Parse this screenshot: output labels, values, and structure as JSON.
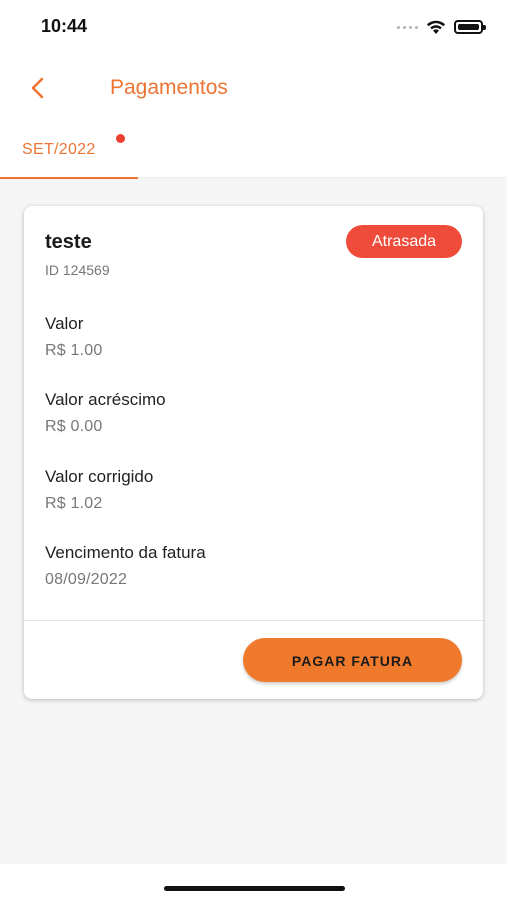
{
  "status_bar": {
    "time": "10:44"
  },
  "header": {
    "title": "Pagamentos"
  },
  "tabs": [
    {
      "label": "SET/2022",
      "has_notification": true
    }
  ],
  "card": {
    "title": "teste",
    "id_label": "ID 124569",
    "status_badge": "Atrasada",
    "fields": [
      {
        "label": "Valor",
        "value": "R$ 1.00"
      },
      {
        "label": "Valor acréscimo",
        "value": "R$ 0.00"
      },
      {
        "label": "Valor corrigido",
        "value": "R$ 1.02"
      },
      {
        "label": "Vencimento da fatura",
        "value": "08/09/2022"
      }
    ],
    "pay_button": "PAGAR FATURA"
  },
  "colors": {
    "accent": "#ee7433",
    "badge": "#ef4b3b",
    "notification_dot": "#ec3f2f",
    "button": "#f07a2c"
  },
  "icons": {
    "back": "chevron-left-icon",
    "wifi": "wifi-icon",
    "battery": "battery-icon",
    "signal": "signal-icon"
  }
}
